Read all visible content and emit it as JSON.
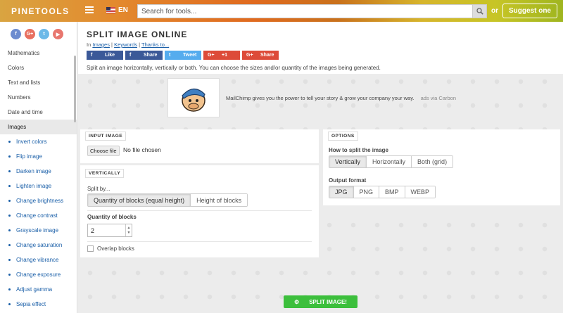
{
  "header": {
    "logo": "PINETOOLS",
    "lang": "EN",
    "search_placeholder": "Search for tools...",
    "or": "or",
    "suggest": "Suggest one"
  },
  "sidebar": {
    "socials": [
      "f",
      "G+",
      "t",
      "▶"
    ],
    "categories": [
      "Mathematics",
      "Colors",
      "Text and lists",
      "Numbers",
      "Date and time",
      "Images"
    ],
    "image_tools": [
      "Invert colors",
      "Flip image",
      "Darken image",
      "Lighten image",
      "Change brightness",
      "Change contrast",
      "Grayscale image",
      "Change saturation",
      "Change vibrance",
      "Change exposure",
      "Adjust gamma",
      "Sepia effect"
    ]
  },
  "page": {
    "title": "SPLIT IMAGE ONLINE",
    "crumb_in": "In",
    "crumb_images": "Images",
    "crumb_keywords": "Keywords",
    "crumb_thanks": "Thanks to...",
    "share": [
      {
        "icon": "f",
        "label": "Like",
        "color": "#3b5998"
      },
      {
        "icon": "f",
        "label": "Share",
        "color": "#3b5998"
      },
      {
        "icon": "t",
        "label": "Tweet",
        "color": "#55acee"
      },
      {
        "icon": "G+",
        "label": "+1",
        "color": "#dd4b39"
      },
      {
        "icon": "G+",
        "label": "Share",
        "color": "#dd4b39"
      }
    ],
    "description": "Split an image horizontally, vertically or both. You can choose the sizes and/or quantity of the images being generated."
  },
  "ad": {
    "text": "MailChimp gives you the power to tell your story & grow your company your way.",
    "via": "ads via Carbon"
  },
  "input_image": {
    "tag": "INPUT IMAGE",
    "choose": "Choose file",
    "no_file": "No file chosen"
  },
  "vertically": {
    "tag": "VERTICALLY",
    "split_by_label": "Split by...",
    "split_by_options": [
      "Quantity of blocks (equal height)",
      "Height of blocks"
    ],
    "quantity_label": "Quantity of blocks",
    "quantity_value": "2",
    "overlap_label": "Overlap blocks"
  },
  "options": {
    "tag": "OPTIONS",
    "how_label": "How to split the image",
    "how_options": [
      "Vertically",
      "Horizontally",
      "Both (grid)"
    ],
    "format_label": "Output format",
    "format_options": [
      "JPG",
      "PNG",
      "BMP",
      "WEBP"
    ]
  },
  "action": {
    "split": "SPLIT IMAGE!"
  }
}
